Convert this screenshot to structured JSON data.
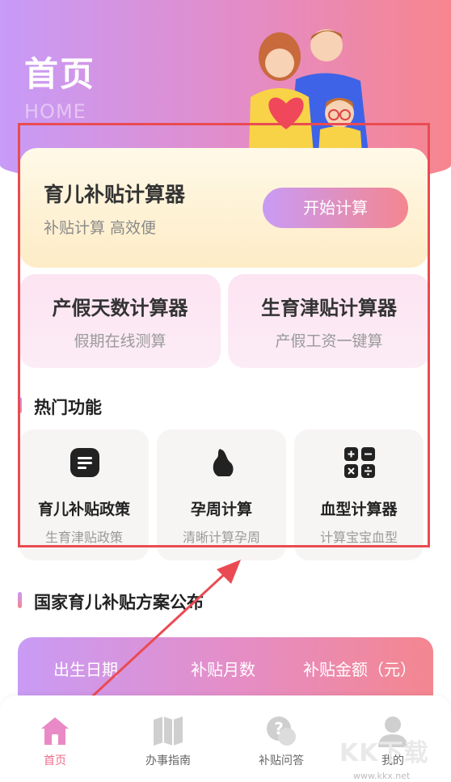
{
  "header": {
    "title": "首页",
    "subtitle": "HOME"
  },
  "calculator_card": {
    "title": "育儿补贴计算器",
    "subtitle": "补贴计算 高效便",
    "button_label": "开始计算"
  },
  "promo_cards": [
    {
      "title": "产假天数计算器",
      "subtitle": "假期在线测算"
    },
    {
      "title": "生育津贴计算器",
      "subtitle": "产假工资一键算"
    }
  ],
  "hot_section": {
    "title": "热门功能"
  },
  "features": [
    {
      "title": "育儿补贴政策",
      "subtitle": "生育津贴政策",
      "icon": "document-icon"
    },
    {
      "title": "孕周计算",
      "subtitle": "清晰计算孕周",
      "icon": "pregnancy-icon"
    },
    {
      "title": "血型计算器",
      "subtitle": "计算宝宝血型",
      "icon": "calculator-icon"
    }
  ],
  "policy_section": {
    "title": "国家育儿补贴方案公布"
  },
  "table": {
    "headers": [
      "出生日期",
      "补贴月数",
      "补贴金额（元）"
    ]
  },
  "tabbar": [
    {
      "label": "首页",
      "icon": "home-icon",
      "active": true
    },
    {
      "label": "办事指南",
      "icon": "map-icon"
    },
    {
      "label": "补贴问答",
      "icon": "question-icon"
    },
    {
      "label": "我的",
      "icon": "user-icon"
    }
  ],
  "watermark": {
    "text": "KK下载",
    "url": "www.kkx.net"
  },
  "colors": {
    "gradient_start": "#c99bf5",
    "gradient_end": "#f4868f",
    "frame": "#ea4b52",
    "active_tab": "#f06b88"
  }
}
